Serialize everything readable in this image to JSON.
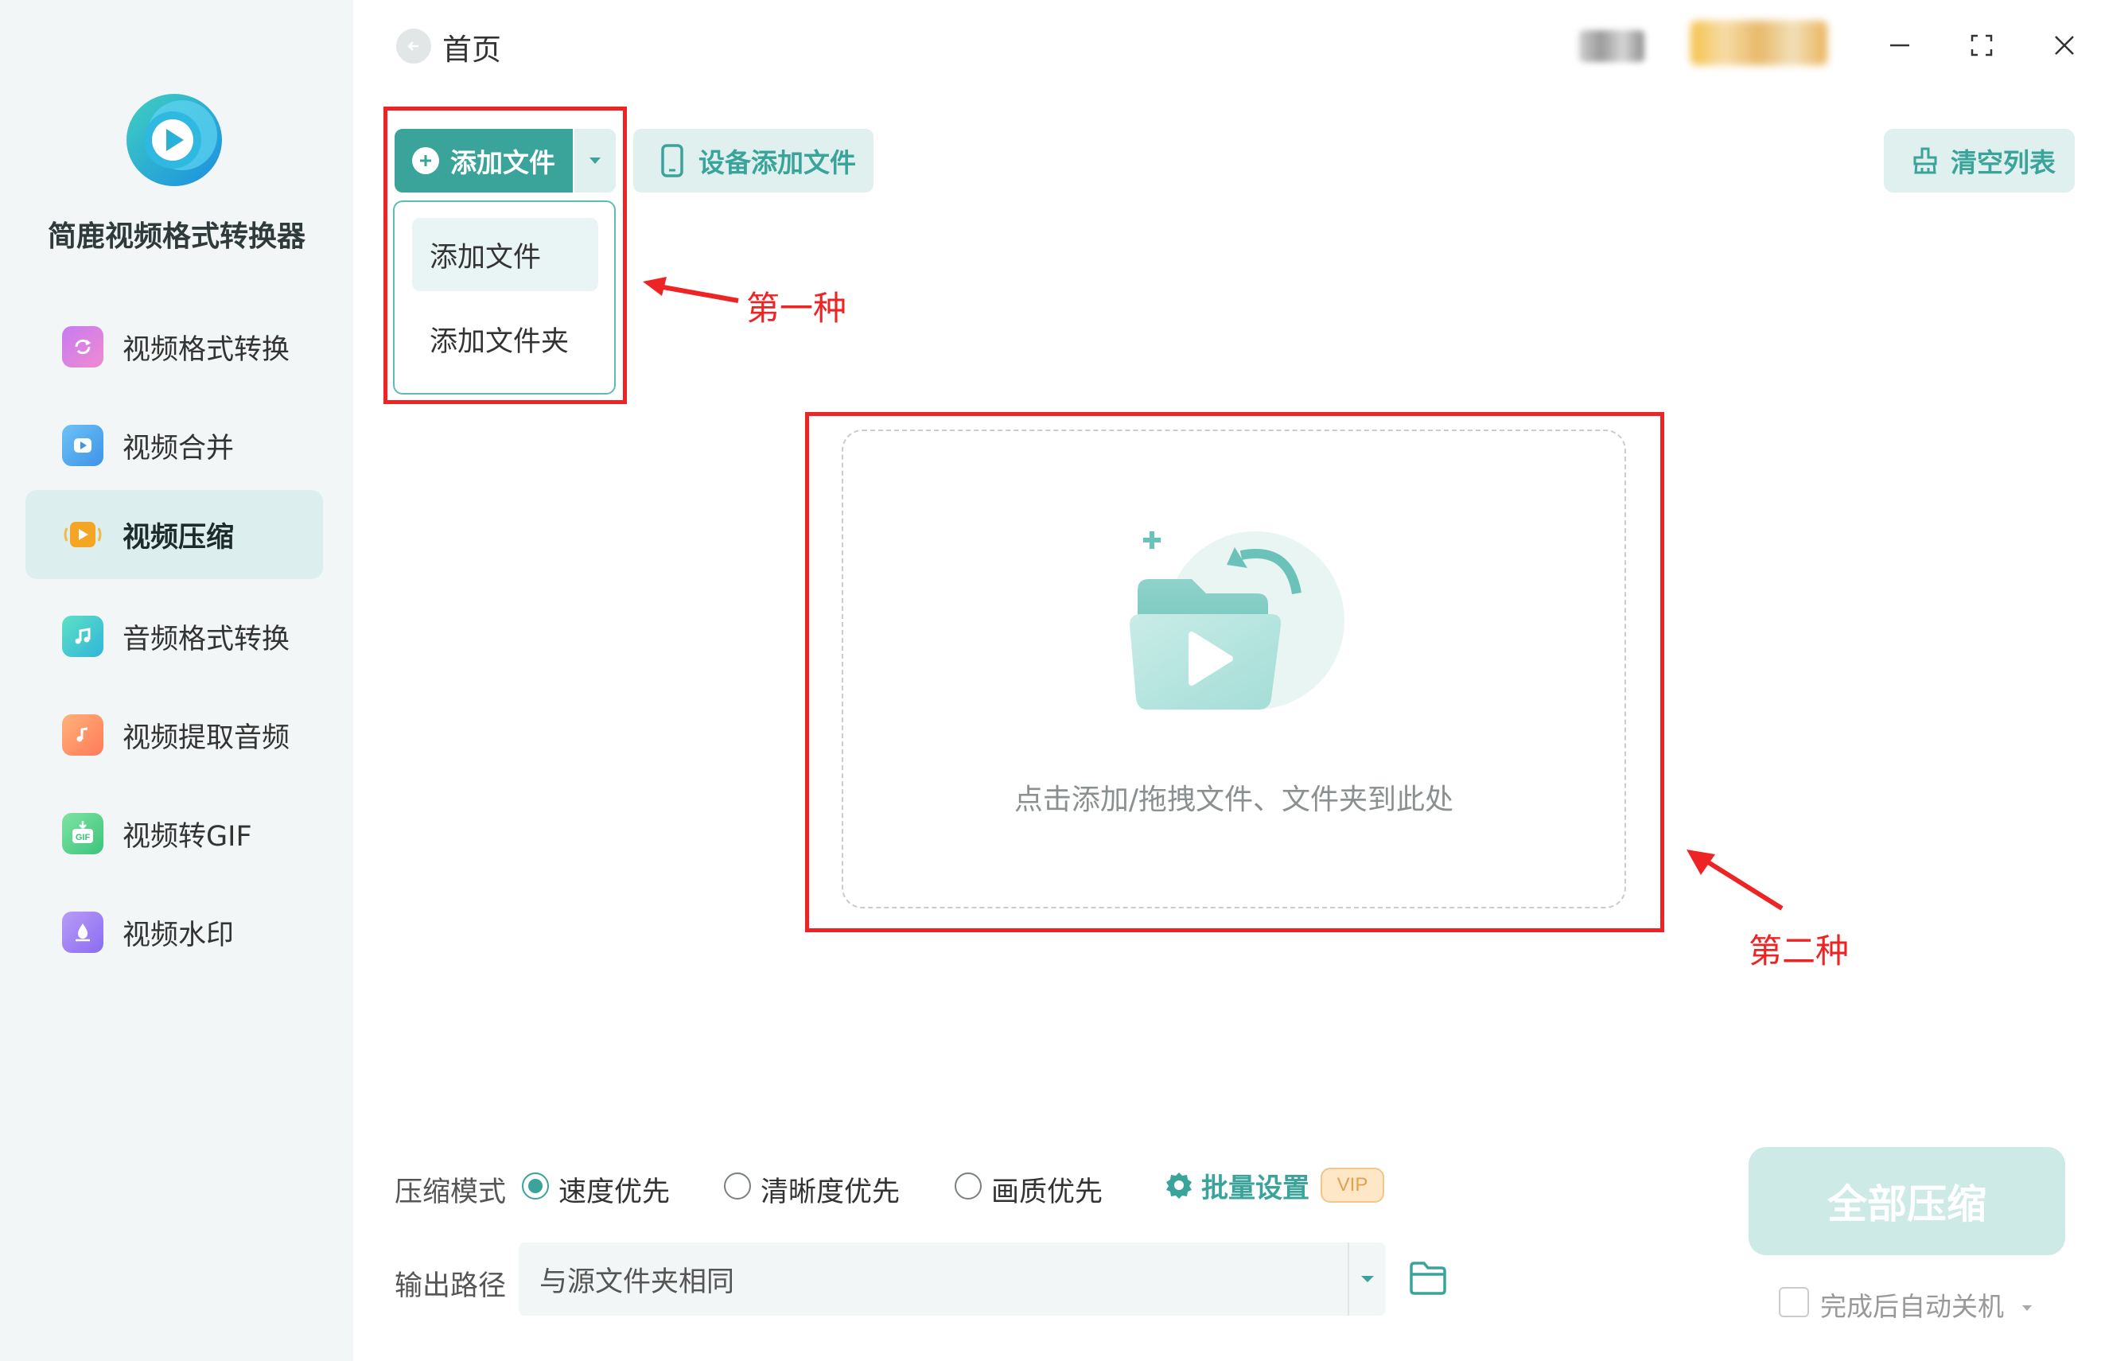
{
  "app": {
    "name": "简鹿视频格式转换器",
    "accent": "#3aa39a"
  },
  "sidebar": {
    "items": [
      {
        "label": "视频格式转换",
        "icon": "video-convert-icon",
        "active": false
      },
      {
        "label": "视频合并",
        "icon": "video-merge-icon",
        "active": false
      },
      {
        "label": "视频压缩",
        "icon": "video-compress-icon",
        "active": true
      },
      {
        "label": "音频格式转换",
        "icon": "audio-convert-icon",
        "active": false
      },
      {
        "label": "视频提取音频",
        "icon": "extract-audio-icon",
        "active": false
      },
      {
        "label": "视频转GIF",
        "icon": "gif-icon",
        "active": false
      },
      {
        "label": "视频水印",
        "icon": "watermark-icon",
        "active": false
      }
    ]
  },
  "header": {
    "breadcrumb": "首页"
  },
  "toolbar": {
    "add_file_label": "添加文件",
    "device_add_label": "设备添加文件",
    "clear_list_label": "清空列表"
  },
  "add_menu": {
    "items": [
      "添加文件",
      "添加文件夹"
    ]
  },
  "annotations": {
    "first": "第一种",
    "second": "第二种",
    "color": "#ee2424"
  },
  "drop_zone": {
    "hint": "点击添加/拖拽文件、文件夹到此处"
  },
  "settings": {
    "compress_mode_label": "压缩模式",
    "modes": [
      {
        "label": "速度优先",
        "selected": true
      },
      {
        "label": "清晰度优先",
        "selected": false
      },
      {
        "label": "画质优先",
        "selected": false
      }
    ],
    "batch_label": "批量设置",
    "vip_label": "VIP",
    "output_path_label": "输出路径",
    "output_path_value": "与源文件夹相同"
  },
  "actions": {
    "compress_all_label": "全部压缩",
    "shutdown_label": "完成后自动关机"
  }
}
